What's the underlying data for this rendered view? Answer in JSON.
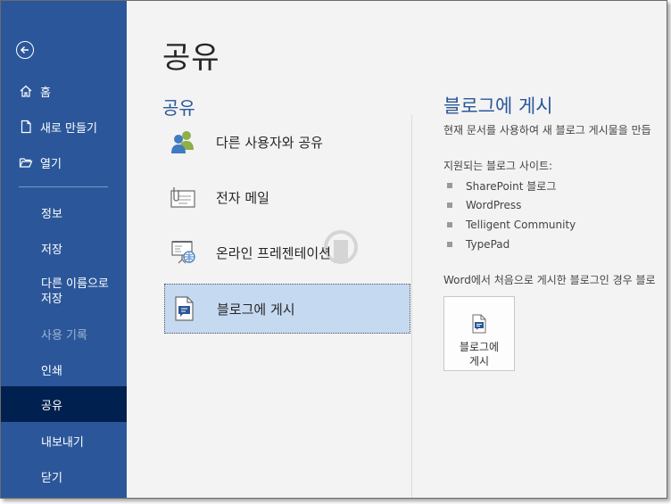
{
  "sidebar": {
    "items": [
      {
        "label": "홈",
        "icon": "home-icon"
      },
      {
        "label": "새로 만들기",
        "icon": "new-document-icon"
      },
      {
        "label": "열기",
        "icon": "open-folder-icon"
      },
      {
        "label": "정보"
      },
      {
        "label": "저장"
      },
      {
        "label": "다른 이름으로 저장"
      },
      {
        "label": "사용 기록",
        "disabled": true
      },
      {
        "label": "인쇄"
      },
      {
        "label": "공유",
        "selected": true
      },
      {
        "label": "내보내기"
      },
      {
        "label": "닫기"
      }
    ],
    "back_icon": "back-arrow-icon"
  },
  "main": {
    "page_title": "공유",
    "section_title": "공유",
    "options": [
      {
        "label": "다른 사용자와 공유",
        "icon": "people-icon"
      },
      {
        "label": "전자 메일",
        "icon": "email-icon"
      },
      {
        "label": "온라인 프레젠테이션",
        "icon": "online-presentation-icon"
      },
      {
        "label": "블로그에 게시",
        "icon": "blog-post-icon",
        "selected": true
      }
    ]
  },
  "detail": {
    "title": "블로그에 게시",
    "description": "현재 문서를 사용하여 새 블로그 게시물을 만듭",
    "supported_label": "지원되는 블로그 사이트:",
    "sites": [
      "SharePoint 블로그",
      "WordPress",
      "Telligent Community",
      "TypePad"
    ],
    "note": "Word에서 처음으로 게시한 블로그인 경우 블로",
    "button_line1": "블로그에",
    "button_line2": "게시"
  },
  "colors": {
    "sidebar_bg": "#2b579a",
    "sidebar_selected": "#002050",
    "accent": "#2b579a",
    "option_selected": "#c5d9f1"
  }
}
